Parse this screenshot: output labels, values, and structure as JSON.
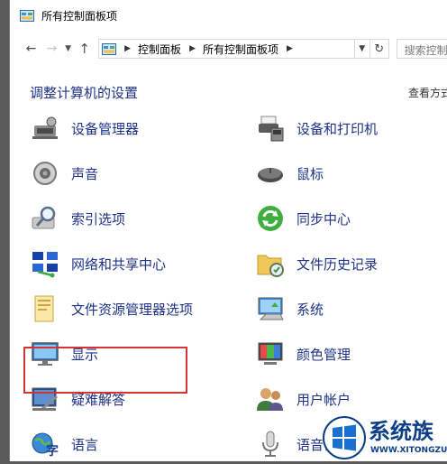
{
  "window": {
    "title": "所有控制面板项"
  },
  "nav": {
    "back_icon": "arrow-left-icon",
    "forward_icon": "arrow-right-icon",
    "recent_icon": "chevron-down-icon",
    "up_icon": "arrow-up-icon",
    "breadcrumb": [
      "控制面板",
      "所有控制面板项"
    ],
    "refresh_icon": "refresh-icon",
    "search_placeholder": "搜索控制"
  },
  "content": {
    "heading": "调整计算机的设置",
    "view_by": "查看方式"
  },
  "items_left": [
    {
      "label": "设备管理器",
      "icon": "device-manager-icon"
    },
    {
      "label": "声音",
      "icon": "speaker-icon"
    },
    {
      "label": "索引选项",
      "icon": "indexing-icon"
    },
    {
      "label": "网络和共享中心",
      "icon": "network-icon",
      "highlighted": true
    },
    {
      "label": "文件资源管理器选项",
      "icon": "folder-options-icon"
    },
    {
      "label": "显示",
      "icon": "monitor-icon"
    },
    {
      "label": "疑难解答",
      "icon": "troubleshoot-icon"
    },
    {
      "label": "语言",
      "icon": "language-icon"
    }
  ],
  "items_right": [
    {
      "label": "设备和打印机",
      "icon": "printer-icon"
    },
    {
      "label": "鼠标",
      "icon": "mouse-icon"
    },
    {
      "label": "同步中心",
      "icon": "sync-icon"
    },
    {
      "label": "文件历史记录",
      "icon": "file-history-icon"
    },
    {
      "label": "系统",
      "icon": "system-icon"
    },
    {
      "label": "颜色管理",
      "icon": "color-management-icon"
    },
    {
      "label": "用户帐户",
      "icon": "user-accounts-icon"
    },
    {
      "label": "语音识别",
      "icon": "microphone-icon"
    }
  ],
  "watermark": {
    "text": "系统族",
    "url": "WWW.XITONGZU.COM"
  },
  "colors": {
    "link": "#1e3287",
    "highlight_border": "#d23434",
    "watermark": "#0c3f86"
  }
}
